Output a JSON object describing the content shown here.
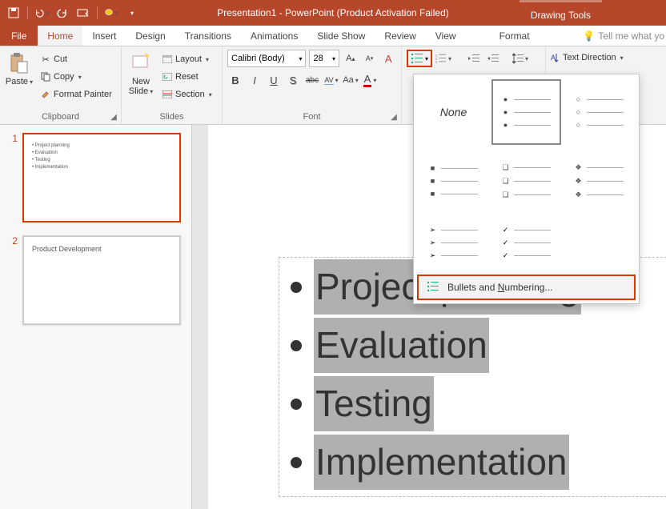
{
  "title": "Presentation1 - PowerPoint (Product Activation Failed)",
  "contextual_tab": "Drawing Tools",
  "tabs": {
    "file": "File",
    "home": "Home",
    "insert": "Insert",
    "design": "Design",
    "transitions": "Transitions",
    "animations": "Animations",
    "slideshow": "Slide Show",
    "review": "Review",
    "view": "View",
    "format": "Format",
    "tellme": "Tell me what yo"
  },
  "clipboard": {
    "paste": "Paste",
    "cut": "Cut",
    "copy": "Copy",
    "format_painter": "Format Painter",
    "group_label": "Clipboard"
  },
  "slides": {
    "new_slide": "New\nSlide",
    "layout": "Layout",
    "reset": "Reset",
    "section": "Section",
    "group_label": "Slides"
  },
  "font": {
    "name": "Calibri (Body)",
    "size": "28",
    "group_label": "Font"
  },
  "paragraph": {
    "text_direction": "Text Direction"
  },
  "thumbs": {
    "num1": "1",
    "num2": "2",
    "slide1_lines": [
      "• Project planning",
      "• Evaluation",
      "• Testing",
      "• Implementation"
    ],
    "slide2_title": "Product Development"
  },
  "slide_content": {
    "items": [
      "Project planning",
      "Evaluation",
      "Testing",
      "Implementation"
    ]
  },
  "dropdown": {
    "none": "None",
    "footer_pre": "Bullets and ",
    "footer_u": "N",
    "footer_post": "umbering..."
  }
}
